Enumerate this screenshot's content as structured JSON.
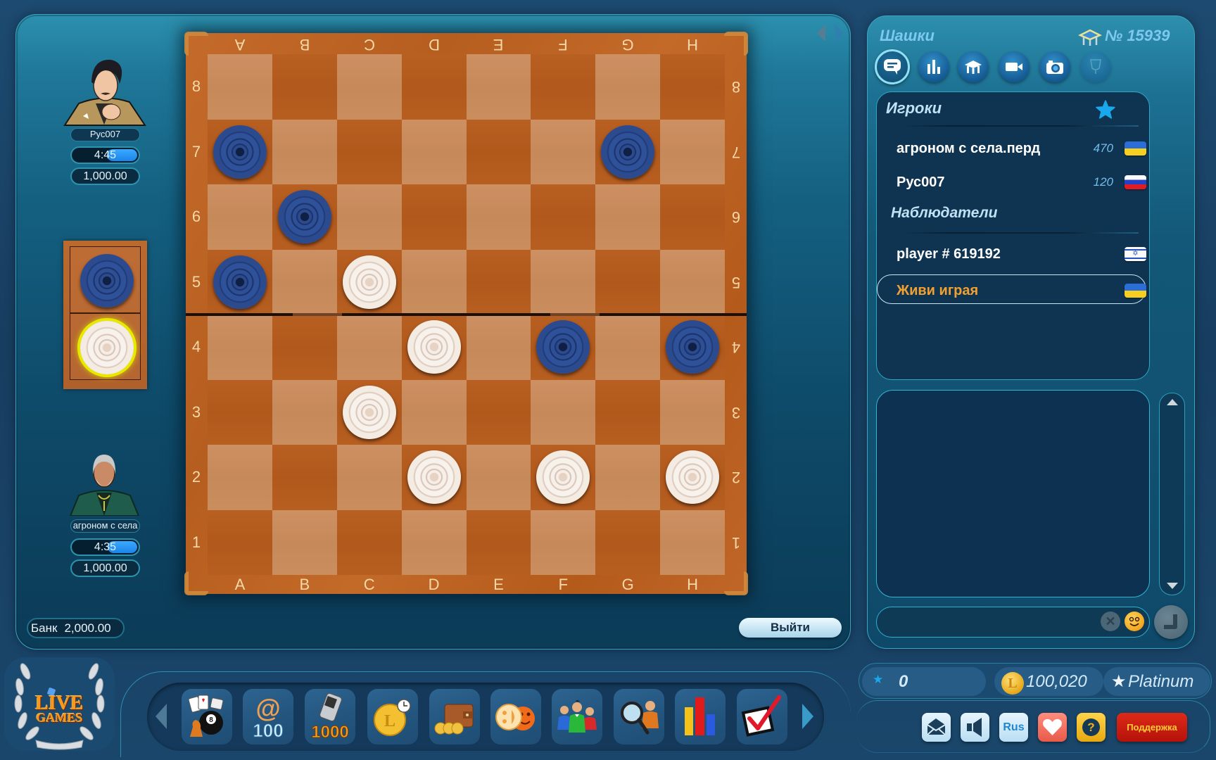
{
  "game_panel": {
    "nav": {
      "prev_icon": "chevron-left-icon",
      "next_icon": "chevron-right-icon"
    },
    "top_player": {
      "name": "Рус007",
      "timer": "4:45",
      "timer_fill": 0.45,
      "balance": "1,000.00",
      "piece_color": "blue"
    },
    "bottom_player": {
      "name": "агроном с села",
      "timer": "4:35",
      "timer_fill": 0.44,
      "balance": "1,000.00",
      "piece_color": "white"
    },
    "turn_indicator": {
      "pieces": [
        "blue",
        "white"
      ],
      "active": "white"
    },
    "bank": {
      "label": "Банк",
      "value": "2,000.00"
    },
    "exit_button": "Выйти"
  },
  "board": {
    "files": [
      "A",
      "B",
      "C",
      "D",
      "E",
      "F",
      "G",
      "H"
    ],
    "ranks": [
      "8",
      "7",
      "6",
      "5",
      "4",
      "3",
      "2",
      "1"
    ],
    "pieces": [
      {
        "square": "A7",
        "color": "blue"
      },
      {
        "square": "G7",
        "color": "blue"
      },
      {
        "square": "B6",
        "color": "blue"
      },
      {
        "square": "A5",
        "color": "blue"
      },
      {
        "square": "F4",
        "color": "blue"
      },
      {
        "square": "H4",
        "color": "blue"
      },
      {
        "square": "C5",
        "color": "white"
      },
      {
        "square": "D4",
        "color": "white"
      },
      {
        "square": "C3",
        "color": "white"
      },
      {
        "square": "D2",
        "color": "white"
      },
      {
        "square": "F2",
        "color": "white"
      },
      {
        "square": "H2",
        "color": "white"
      }
    ],
    "colors": {
      "light_square": "#c98b5b",
      "dark_square": "#b45c1f",
      "frame": "#c06628",
      "label": "#f7d8a8",
      "blue_piece": "#2c4b8f",
      "white_piece": "#f4ebe3",
      "turn_highlight": "#e8e800"
    }
  },
  "side_panel": {
    "title": "Шашки",
    "table_number": "№ 15939",
    "table_icon": "table-icon",
    "tabs": [
      {
        "id": "chat",
        "icon": "chat-icon",
        "selected": true
      },
      {
        "id": "statistics",
        "icon": "bar-chart-icon"
      },
      {
        "id": "tables",
        "icon": "table-icon"
      },
      {
        "id": "video",
        "icon": "video-camera-icon"
      },
      {
        "id": "photo",
        "icon": "camera-icon"
      },
      {
        "id": "trophy",
        "icon": "trophy-icon",
        "disabled": true
      }
    ],
    "players_header": "Игроки",
    "favorites_icon": "star-icon",
    "players": [
      {
        "name": "агроном с села.перд",
        "score": "470",
        "flag": "ua"
      },
      {
        "name": "Рус007",
        "score": "120",
        "flag": "ru"
      }
    ],
    "observers_header": "Наблюдатели",
    "observers": [
      {
        "name": "player # 619192",
        "flag": "il"
      },
      {
        "name": "Живи играя",
        "flag": "ua",
        "highlighted": true
      }
    ],
    "highlight_color": "#f2a030",
    "chat": {
      "input_value": "",
      "clear_icon": "✕"
    }
  },
  "stats": {
    "stars": "0",
    "coin_symbol": "L",
    "coins": "100,020",
    "status": "Platinum"
  },
  "buttons": {
    "lang": "Rus",
    "help": "?",
    "support": "Поддержка"
  },
  "logo": {
    "line1": "LIVE",
    "line2": "GAMES"
  },
  "toolbar": {
    "items": [
      {
        "icon": "games-icon",
        "badge": "8"
      },
      {
        "icon": "email-bonus-icon",
        "symbol": "@",
        "badge": "100"
      },
      {
        "icon": "phone-bonus-icon",
        "badge": "1000"
      },
      {
        "icon": "coin-timer-icon",
        "badge": "L"
      },
      {
        "icon": "wallet-icon"
      },
      {
        "icon": "smileys-icon"
      },
      {
        "icon": "friends-icon"
      },
      {
        "icon": "search-player-icon"
      },
      {
        "icon": "rating-chart-icon"
      },
      {
        "icon": "tasks-check-icon"
      }
    ]
  }
}
